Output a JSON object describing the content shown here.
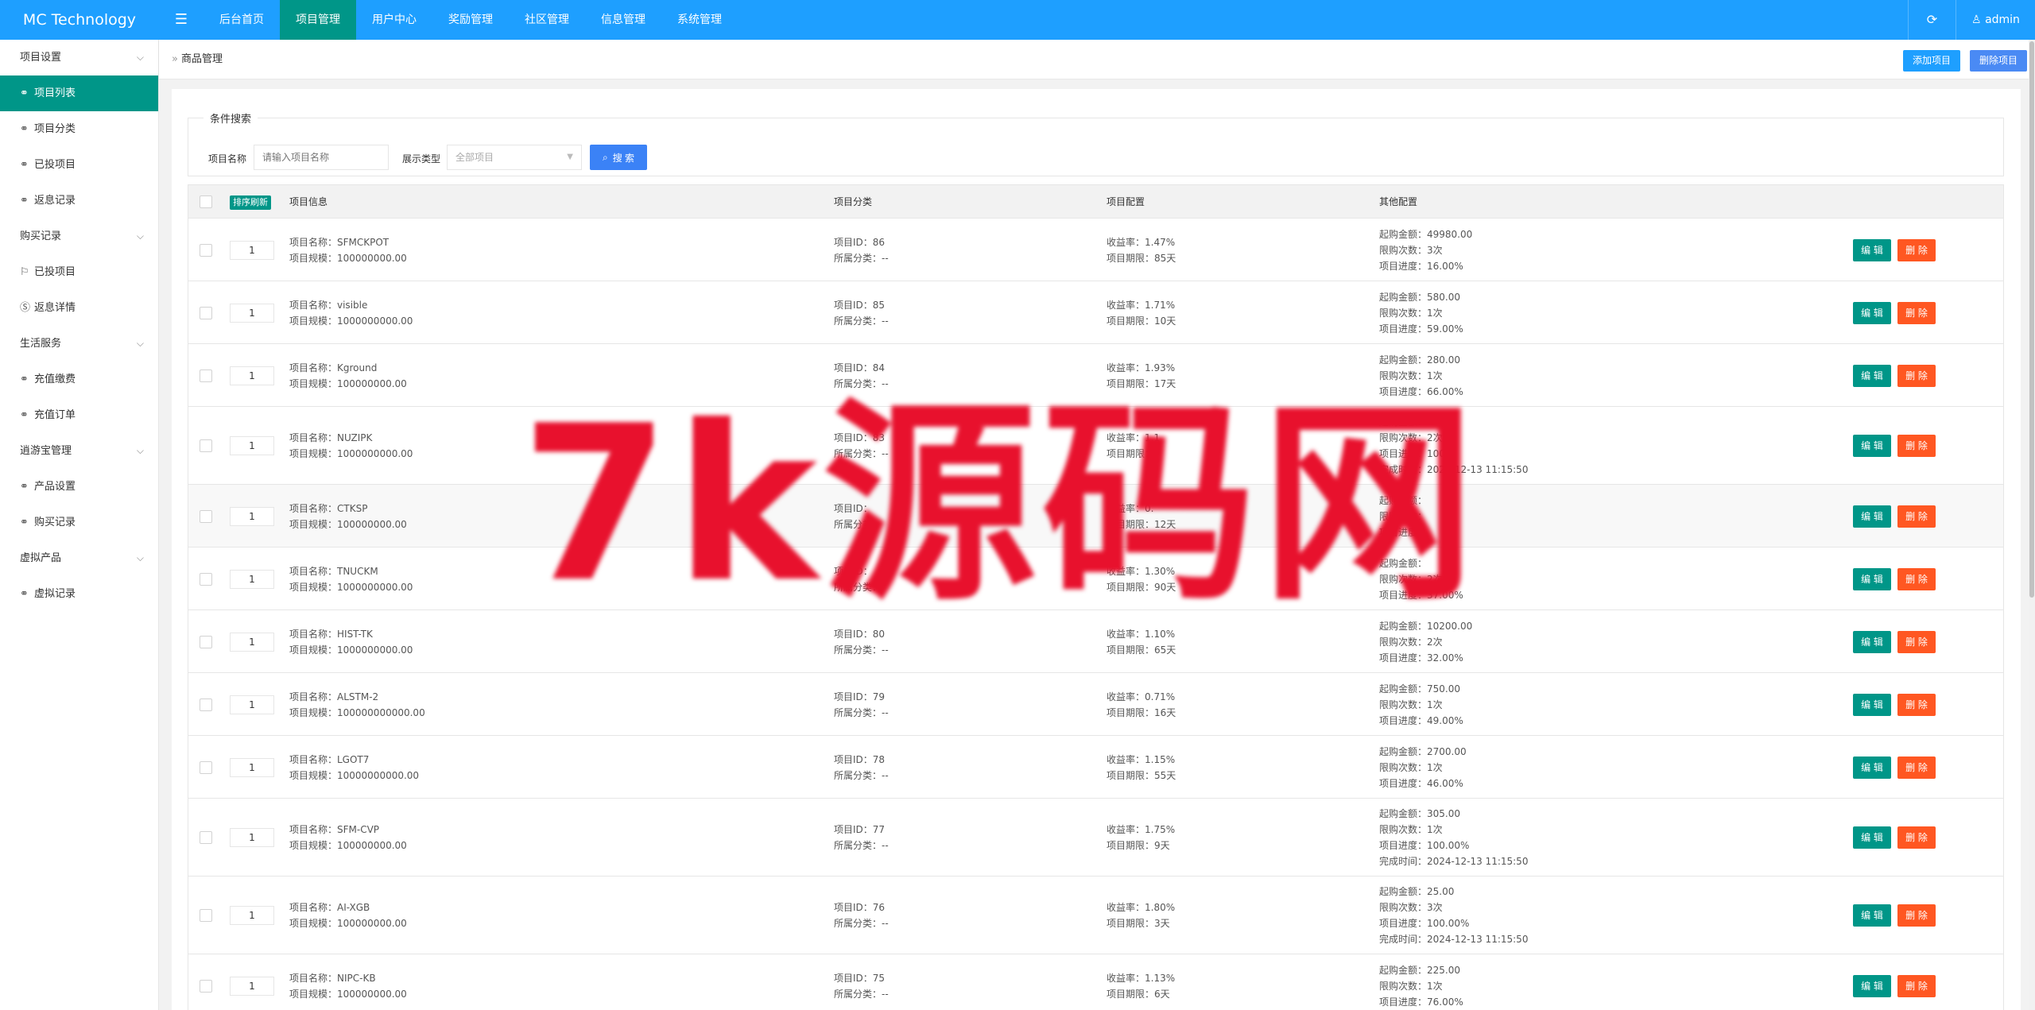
{
  "app": {
    "title": "MC Technology"
  },
  "topnav": [
    {
      "label": "后台首页"
    },
    {
      "label": "项目管理"
    },
    {
      "label": "用户中心"
    },
    {
      "label": "奖励管理"
    },
    {
      "label": "社区管理"
    },
    {
      "label": "信息管理"
    },
    {
      "label": "系统管理"
    }
  ],
  "user": {
    "name": "admin"
  },
  "sidebar": {
    "groups": [
      {
        "label": "项目设置",
        "items": [
          {
            "label": "项目列表",
            "icon": "link-icon"
          },
          {
            "label": "项目分类",
            "icon": "link-icon"
          },
          {
            "label": "已投项目",
            "icon": "link-icon"
          },
          {
            "label": "返息记录",
            "icon": "link-icon"
          }
        ]
      },
      {
        "label": "购买记录",
        "items": [
          {
            "label": "已投项目",
            "icon": "flag-icon"
          },
          {
            "label": "返息详情",
            "icon": "coin-icon"
          }
        ]
      },
      {
        "label": "生活服务",
        "items": [
          {
            "label": "充值缴费",
            "icon": "link-icon"
          },
          {
            "label": "充值订单",
            "icon": "link-icon"
          }
        ]
      },
      {
        "label": "逍游宝管理",
        "items": [
          {
            "label": "产品设置",
            "icon": "link-icon"
          },
          {
            "label": "购买记录",
            "icon": "link-icon"
          }
        ]
      },
      {
        "label": "虚拟产品",
        "items": [
          {
            "label": "虚拟记录",
            "icon": "link-icon"
          }
        ]
      }
    ]
  },
  "page": {
    "breadcrumb": "商品管理",
    "add_button": "添加项目",
    "delete_button": "删除项目"
  },
  "search": {
    "legend": "条件搜索",
    "name_label": "项目名称",
    "name_placeholder": "请输入项目名称",
    "type_label": "展示类型",
    "type_value": "全部项目",
    "button": "搜 索"
  },
  "table": {
    "sort_button": "排序刷新",
    "columns": [
      "项目信息",
      "项目分类",
      "项目配置",
      "其他配置"
    ],
    "edit_label": "编 辑",
    "delete_label": "删 除",
    "rows": [
      {
        "sort": "1",
        "info": [
          "项目名称：SFMCKPOT",
          "项目规模：100000000.00"
        ],
        "cat": [
          "项目ID：86",
          "所属分类：--"
        ],
        "conf": [
          "收益率：1.47%",
          "项目期限：85天"
        ],
        "other": [
          "起购金额：49980.00",
          "限购次数：3次",
          "项目进度：16.00%"
        ]
      },
      {
        "sort": "1",
        "info": [
          "项目名称：visible",
          "项目规模：1000000000.00"
        ],
        "cat": [
          "项目ID：85",
          "所属分类：--"
        ],
        "conf": [
          "收益率：1.71%",
          "项目期限：10天"
        ],
        "other": [
          "起购金额：580.00",
          "限购次数：1次",
          "项目进度：59.00%"
        ]
      },
      {
        "sort": "1",
        "info": [
          "项目名称：Kground",
          "项目规模：100000000.00"
        ],
        "cat": [
          "项目ID：84",
          "所属分类：--"
        ],
        "conf": [
          "收益率：1.93%",
          "项目期限：17天"
        ],
        "other": [
          "起购金额：280.00",
          "限购次数：1次",
          "项目进度：66.00%"
        ]
      },
      {
        "sort": "1",
        "info": [
          "项目名称：NUZIPK",
          "项目规模：1000000000.00"
        ],
        "cat": [
          "项目ID：83",
          "所属分类：--"
        ],
        "conf": [
          "收益率：1.1",
          "项目期限："
        ],
        "other": [
          "起购金额：",
          "限购次数：2次",
          "项目进度：100.0",
          "完成时间：2024-12-13 11:15:50"
        ]
      },
      {
        "sort": "1",
        "info": [
          "项目名称：CTKSP",
          "项目规模：100000000.00"
        ],
        "cat": [
          "项目ID：",
          "所属分类："
        ],
        "conf": [
          "收益率：0.",
          "项目期限：12天"
        ],
        "other": [
          "起购金额：",
          "限购次数：",
          "项目进度："
        ]
      },
      {
        "sort": "1",
        "info": [
          "项目名称：TNUCKM",
          "项目规模：1000000000.00"
        ],
        "cat": [
          "项目ID：",
          "所属分类："
        ],
        "conf": [
          "收益率：1.30%",
          "项目期限：90天"
        ],
        "other": [
          "起购金额：",
          "限购次数：2次",
          "项目进度：37.00%"
        ]
      },
      {
        "sort": "1",
        "info": [
          "项目名称：HIST-TK",
          "项目规模：1000000000.00"
        ],
        "cat": [
          "项目ID：80",
          "所属分类：--"
        ],
        "conf": [
          "收益率：1.10%",
          "项目期限：65天"
        ],
        "other": [
          "起购金额：10200.00",
          "限购次数：2次",
          "项目进度：32.00%"
        ]
      },
      {
        "sort": "1",
        "info": [
          "项目名称：ALSTM-2",
          "项目规模：100000000000.00"
        ],
        "cat": [
          "项目ID：79",
          "所属分类：--"
        ],
        "conf": [
          "收益率：0.71%",
          "项目期限：16天"
        ],
        "other": [
          "起购金额：750.00",
          "限购次数：1次",
          "项目进度：49.00%"
        ]
      },
      {
        "sort": "1",
        "info": [
          "项目名称：LGOT7",
          "项目规模：10000000000.00"
        ],
        "cat": [
          "项目ID：78",
          "所属分类：--"
        ],
        "conf": [
          "收益率：1.15%",
          "项目期限：55天"
        ],
        "other": [
          "起购金额：2700.00",
          "限购次数：1次",
          "项目进度：46.00%"
        ]
      },
      {
        "sort": "1",
        "info": [
          "项目名称：SFM-CVP",
          "项目规模：100000000.00"
        ],
        "cat": [
          "项目ID：77",
          "所属分类：--"
        ],
        "conf": [
          "收益率：1.75%",
          "项目期限：9天"
        ],
        "other": [
          "起购金额：305.00",
          "限购次数：1次",
          "项目进度：100.00%",
          "完成时间：2024-12-13 11:15:50"
        ]
      },
      {
        "sort": "1",
        "info": [
          "项目名称：AI-XGB",
          "项目规模：100000000.00"
        ],
        "cat": [
          "项目ID：76",
          "所属分类：--"
        ],
        "conf": [
          "收益率：1.80%",
          "项目期限：3天"
        ],
        "other": [
          "起购金额：25.00",
          "限购次数：3次",
          "项目进度：100.00%",
          "完成时间：2024-12-13 11:15:50"
        ]
      },
      {
        "sort": "1",
        "info": [
          "项目名称：NIPC-KB",
          "项目规模：100000000.00"
        ],
        "cat": [
          "项目ID：75",
          "所属分类：--"
        ],
        "conf": [
          "收益率：1.13%",
          "项目期限：6天"
        ],
        "other": [
          "起购金额：225.00",
          "限购次数：1次",
          "项目进度：76.00%"
        ]
      }
    ]
  },
  "watermark": "7k源码网"
}
